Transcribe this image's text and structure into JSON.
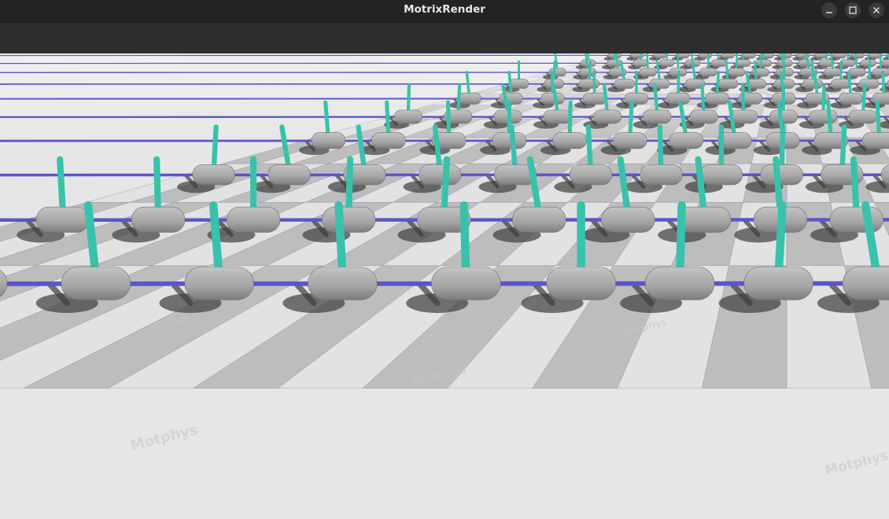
{
  "window": {
    "title": "MotrixRender"
  },
  "window_controls": [
    {
      "name": "minimize-button",
      "icon": "minimize-icon"
    },
    {
      "name": "maximize-button",
      "icon": "maximize-icon"
    },
    {
      "name": "close-button",
      "icon": "close-icon"
    }
  ],
  "scene": {
    "watermark_text": "Motphys",
    "floor_colors": {
      "light": "#e2e2e2",
      "dark": "#bdbdbd",
      "grid_line": "#8a8aa8"
    },
    "rope_color": "#5b55c9",
    "pole_color": "#38c2ac",
    "base_color": "#a9a9a9",
    "shadow_color": "#3e3e3e"
  }
}
